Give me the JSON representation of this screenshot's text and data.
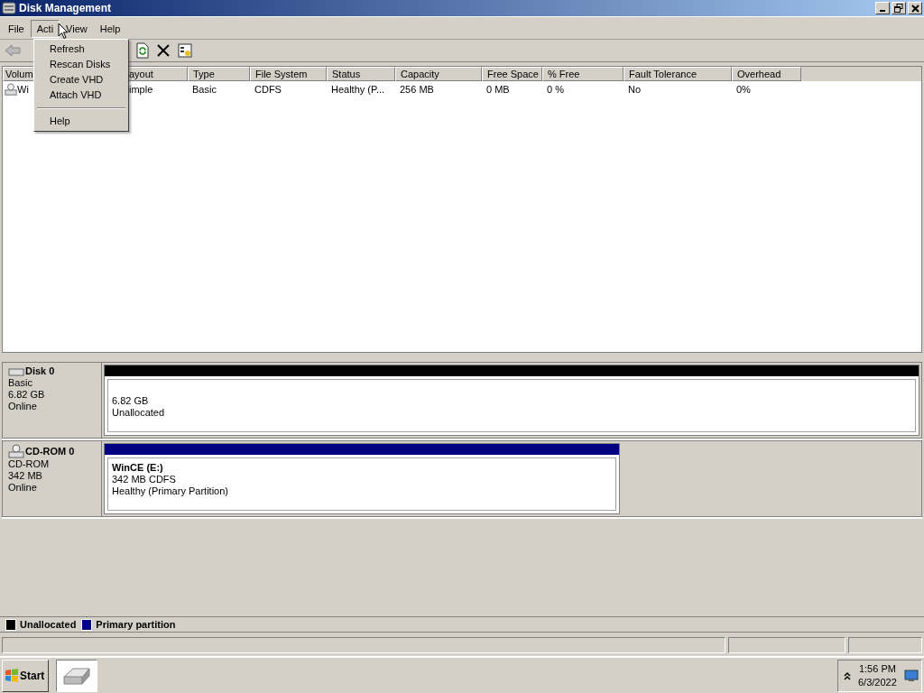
{
  "window": {
    "title": "Disk Management"
  },
  "menubar": [
    {
      "label": "File",
      "selected": false
    },
    {
      "label": "Acti",
      "selected": true
    },
    {
      "label": "View",
      "selected": false
    },
    {
      "label": "Help",
      "selected": false
    }
  ],
  "open_menu": [
    {
      "kind": "item",
      "label": "Refresh"
    },
    {
      "kind": "item",
      "label": "Rescan Disks"
    },
    {
      "kind": "item",
      "label": "Create VHD"
    },
    {
      "kind": "item",
      "label": "Attach VHD"
    },
    {
      "kind": "separator"
    },
    {
      "kind": "item",
      "label": "Help"
    }
  ],
  "table": {
    "columns": [
      "Volum",
      "ayout",
      "Type",
      "File System",
      "Status",
      "Capacity",
      "Free Space",
      "% Free",
      "Fault Tolerance",
      "Overhead"
    ],
    "rows": [
      [
        "Wi",
        "imple",
        "Basic",
        "CDFS",
        "Healthy (P...",
        "256 MB",
        "0 MB",
        "0 %",
        "No",
        "0%"
      ]
    ]
  },
  "disks": [
    {
      "kind": "disk",
      "name": "Disk 0",
      "type": "Basic",
      "size": "6.82 GB",
      "status": "Online",
      "partition": {
        "color": "#000000",
        "lines": [
          "6.82 GB",
          "Unallocated"
        ]
      }
    },
    {
      "kind": "cdrom",
      "name": "CD-ROM 0",
      "type": "CD-ROM",
      "size": "342 MB",
      "status": "Online",
      "partition": {
        "color": "#000080",
        "title": "WinCE  (E:)",
        "lines": [
          "342 MB CDFS",
          "Healthy (Primary Partition)"
        ]
      }
    }
  ],
  "legend": [
    {
      "label": "Unallocated",
      "color": "#000000"
    },
    {
      "label": "Primary partition",
      "color": "#000080"
    }
  ],
  "taskbar": {
    "start": "Start",
    "time": "1:56 PM",
    "date": "6/3/2022"
  }
}
